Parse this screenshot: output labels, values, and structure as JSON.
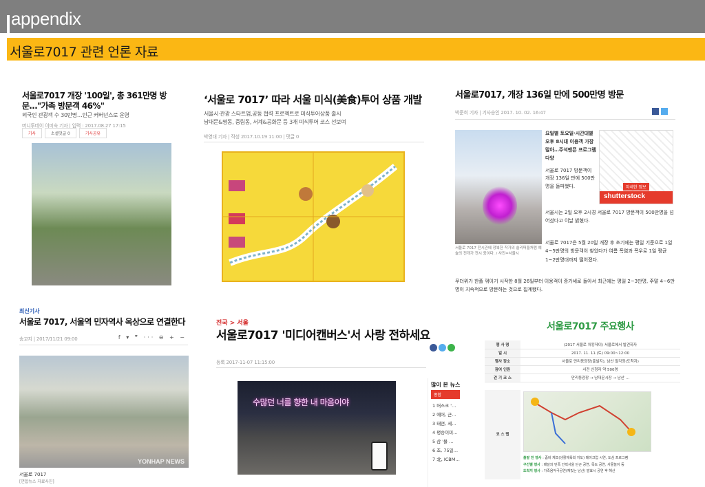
{
  "header": {
    "title": "appendix",
    "subtitle": "서울로7017 관련 언론 자료"
  },
  "clip1": {
    "headline": "서울로7017 개장 '100일', 총 361만명 방문…\"가족 방문객 46%\"",
    "subhead": "외국인 관광객 수 30만명…인근 커버넌스로 운영",
    "meta": "머니투데이 이미숙 기자  |  입력 : 2017.08.27 17:15",
    "tags": [
      "기사",
      "소셜댓글 0",
      "기사공유"
    ]
  },
  "clip2": {
    "headline": "‘서울로 7017’ 따라 서울 미식(美食)투어 상품 개발",
    "desc1": "서울시·관광 스타트업,공동 협력 프로젝트로 미식투어상품 출시",
    "desc2": "남대문&명동, 중림동, 서계&공화문 등 3개 미식투어 코스 선보여",
    "meta": "박영대 기자   |   작성 2017.10.19 11:00   |   댓글 0"
  },
  "clip3": {
    "headline": "서울로7017, 개장 136일 만에 500만명 방문",
    "byline": "박준희 기자   |   기사승인 2017. 10. 02. 16:47",
    "col": "요일별 토요일·시간대별 오후 8시대 이용객 가장 많아…주석맨픈 프로그램 다양",
    "col2": "서울로 7017 방문객이 개장 136일 만에 500만명을 돌파했다.",
    "p1": "서울시는 2일 오후 2시경 서울로 7017 방문객이 500만명을 넘어섰다고 이날 밝혔다.",
    "p2": "서울로 7017은 5월 20일 개장 후 초기에는 평일 기준으로 1일 4~5만명의 방문객이 찾았다가 여름 폭염과 폭우로 1일 평균 1~2만명대까지 떨어졌다.",
    "p3": "무더위가 한풀 꺾이기 시작한 8월 26일부터 이용객이 증가세로 돌아서 최근에는 평일 2~3만명, 주말 4~6만명이 지속적으로 방문하는 것으로 집계됐다.",
    "caption": "서울로 7017 전시관에 정복한 작가의 슬리퍼들처럼 예술의 전개가 전시 중이다. / 사진=서울시",
    "ad_btn": "자세한 정보",
    "ad_brand": "shutterstock"
  },
  "clip4": {
    "kicker": "최신기사",
    "headline": "서울로 7017, 서울역 민자역사 옥상으로 연결한다",
    "meta": "송교지  |  2017/11/21 09:00",
    "cap1": "서울로 7017",
    "cap2": "[연합뉴스 자료사진]",
    "watermark": "YONHAP NEWS"
  },
  "clip5": {
    "kicker": "전국 > 서울",
    "headline": "서울로7017 '미디어캔버스'서 사랑 전하세요",
    "meta": "등록 2017-11-07 11:15:00",
    "sign": "수많던 너를 향한 내 마음이야",
    "popular_title": "많이 본 뉴스",
    "popular_btn": "종합",
    "popular": [
      "1  머스크 '…",
      "2  에어, 근…",
      "3  태연, 세…",
      "4  평승이미…",
      "5  삼 '물 …",
      "6  조, 75일…",
      "7  北, ICBM…"
    ]
  },
  "clip6": {
    "title": "서울로7017 주요행사",
    "rows": [
      {
        "k": "행 사 명",
        "v": "(2017 서울로 워킹데이) 서울로에서 발견하자"
      },
      {
        "k": "일   시",
        "v": "2017. 11. 11.(토) 09:00~12:00"
      },
      {
        "k": "행사 장소",
        "v": "서울로 만리동광장(출발지), 남산 팔각정(도착지)"
      },
      {
        "k": "참여 인원",
        "v": "사전 신청자 약 500명"
      },
      {
        "k": "걷 기 코 스",
        "v": "만리동광장 → 남대문시장 → 남산 …"
      }
    ],
    "course_label": "코 스 맵",
    "list": [
      {
        "k": "출발 전 행사",
        "v": "줌바 체조(생활체육회 지도) 메이크업 시연, 도심 프로그램"
      },
      {
        "k": "구간별 행사",
        "v": "배달의 민족 인빅서울 단근 공연, 목도 공연, 사물놀이 등"
      },
      {
        "k": "도착지 행사",
        "v": "가족음악극공연(재밌는 남산) 발효시 공연 후 해산"
      }
    ]
  }
}
